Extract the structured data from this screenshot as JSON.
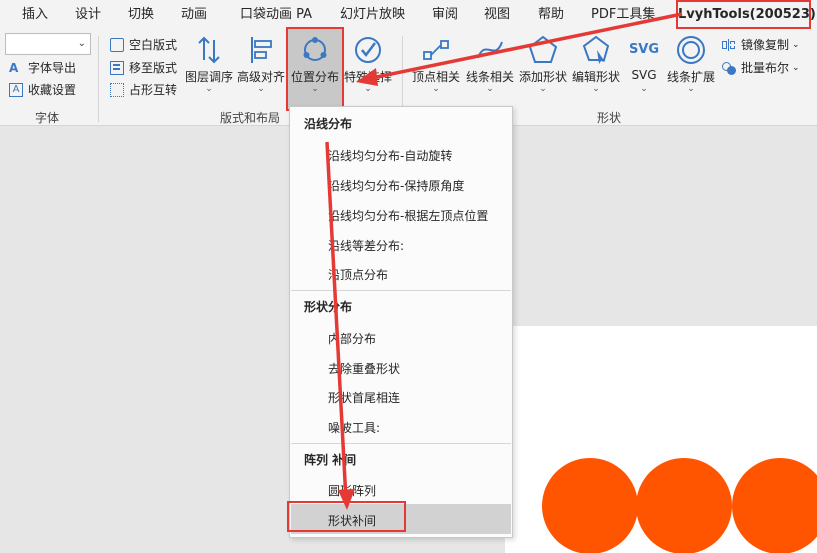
{
  "tabs": [
    "插入",
    "设计",
    "切换",
    "动画",
    "口袋动画 PA",
    "幻灯片放映",
    "审阅",
    "视图",
    "帮助",
    "PDF工具集",
    "LvyhTools(200523)"
  ],
  "font_group": {
    "font_select_value": "",
    "export_label": "字体导出",
    "favorites_label": "收藏设置",
    "group_label": "字体"
  },
  "layout_group": {
    "blank_layout": "空白版式",
    "move_to_layout": "移至版式",
    "placeholder_swap": "占形互转",
    "layer_adjust": "图层调序",
    "advanced_align": "高级对齐",
    "position_distribute": "位置分布",
    "special_select": "特殊选择",
    "group_label": "版式和布局"
  },
  "shape_group": {
    "vertex": "顶点相关",
    "line": "线条相关",
    "add_shape": "添加形状",
    "edit_shape": "编辑形状",
    "svg_label": "SVG",
    "svg_icon_text": "SVG",
    "line_extend": "线条扩展",
    "mirror_copy": "镜像复制",
    "batch_boolean": "批量布尔",
    "group_label": "形状"
  },
  "menu": {
    "section1": "沿线分布",
    "items1": [
      "沿线均匀分布-自动旋转",
      "沿线均匀分布-保持原角度",
      "沿线均匀分布-根据左顶点位置",
      "沿线等差分布:",
      "沿顶点分布"
    ],
    "section2": "形状分布",
    "items2": [
      "内部分布",
      "去除重叠形状",
      "形状首尾相连",
      "噪波工具:"
    ],
    "section3": "阵列 补间",
    "items3": [
      "圆形阵列",
      "形状补间"
    ]
  },
  "colors": {
    "accent_red": "#e53935",
    "circle_orange": "#ff5400",
    "icon_blue": "#3a78c4"
  }
}
